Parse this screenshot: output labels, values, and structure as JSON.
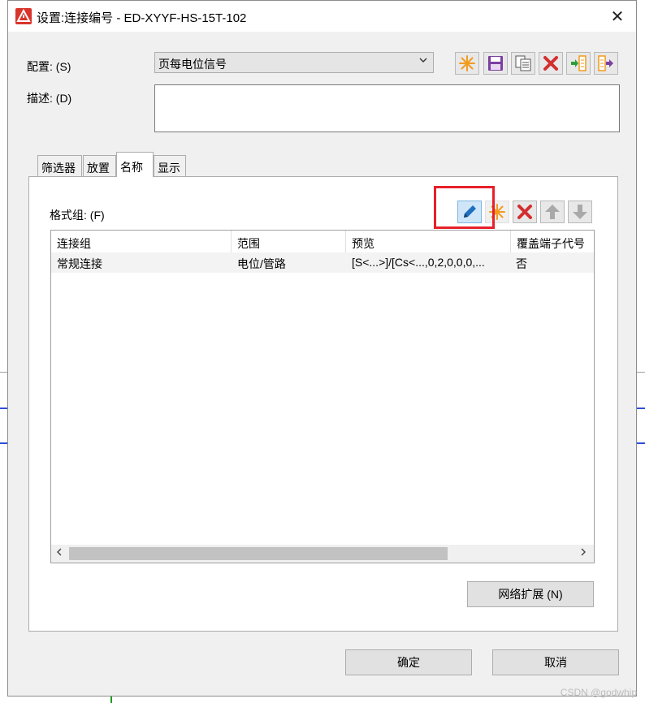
{
  "window": {
    "title": "设置:连接编号 - ED-XYYF-HS-15T-102",
    "close_glyph": "✕"
  },
  "config": {
    "label": "配置: (S)",
    "selected": "页每电位信号"
  },
  "description": {
    "label": "描述: (D)",
    "value": ""
  },
  "tabs": [
    {
      "label": "筛选器"
    },
    {
      "label": "放置"
    },
    {
      "label": "名称"
    },
    {
      "label": "显示"
    }
  ],
  "format_group": {
    "label": "格式组: (F)"
  },
  "table": {
    "columns": [
      "连接组",
      "范围",
      "预览",
      "覆盖端子代号"
    ],
    "rows": [
      [
        "常规连接",
        "电位/管路",
        "[S<...>]/[Cs<...,0,2,0,0,0,...",
        "否"
      ]
    ]
  },
  "buttons": {
    "network_expand": "网络扩展 (N)",
    "ok": "确定",
    "cancel": "取消"
  },
  "toolbar_icons": [
    "new-icon",
    "save-icon",
    "copy-icon",
    "delete-icon",
    "import-icon",
    "export-icon"
  ],
  "format_icons": [
    "edit-icon",
    "new-icon",
    "delete-icon",
    "move-up-icon",
    "move-down-icon"
  ],
  "colors": {
    "highlight": "#e8202a",
    "accent_red": "#d32f2f",
    "accent_orange": "#f29b1e"
  },
  "watermark": "CSDN @godwhip"
}
